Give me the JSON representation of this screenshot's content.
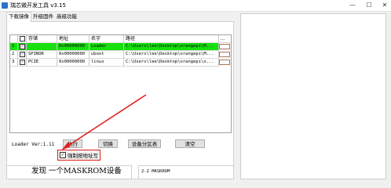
{
  "window": {
    "title": "瑞芯微开发工具 v3.15",
    "minimize": "—",
    "maximize": "☐",
    "close": "✕"
  },
  "tabs": [
    {
      "label": "下载镜像",
      "active": true
    },
    {
      "label": "升级固件",
      "active": false
    },
    {
      "label": "高级功能",
      "active": false
    }
  ],
  "grid": {
    "headers": {
      "check": "☐",
      "storage": "存储",
      "address": "地址",
      "name": "名字",
      "path": "路径",
      "extra": "..."
    },
    "rows": [
      {
        "num": "1",
        "checked": "✓",
        "storage": "",
        "address": "0x00000000",
        "name": "Loader",
        "path": "C:\\Users\\lee\\Desktop\\orangepi\\M..."
      },
      {
        "num": "2",
        "checked": "✓",
        "storage": "SPINOR",
        "address": "0x00000000",
        "name": "uboot",
        "path": "C:\\Users\\lee\\Desktop\\orangepi\\M..."
      },
      {
        "num": "3",
        "checked": "✓",
        "storage": "PCIE",
        "address": "0x00000000",
        "name": "linux",
        "path": "C:\\Users\\lee\\Desktop\\orangepi\\o..."
      }
    ]
  },
  "loader_version": "Loader Ver:1.11",
  "buttons": {
    "run": "执行",
    "switch": "切换",
    "partition": "设备分区表",
    "clear": "清空"
  },
  "force_write": {
    "checked": "✓",
    "label": "强制按地址写"
  },
  "status": {
    "message": "发现 一个MASKROM设备",
    "device": "2-2   MASKROM"
  },
  "colors": {
    "highlight_row": "#16e00e",
    "annotation": "#e02020"
  }
}
